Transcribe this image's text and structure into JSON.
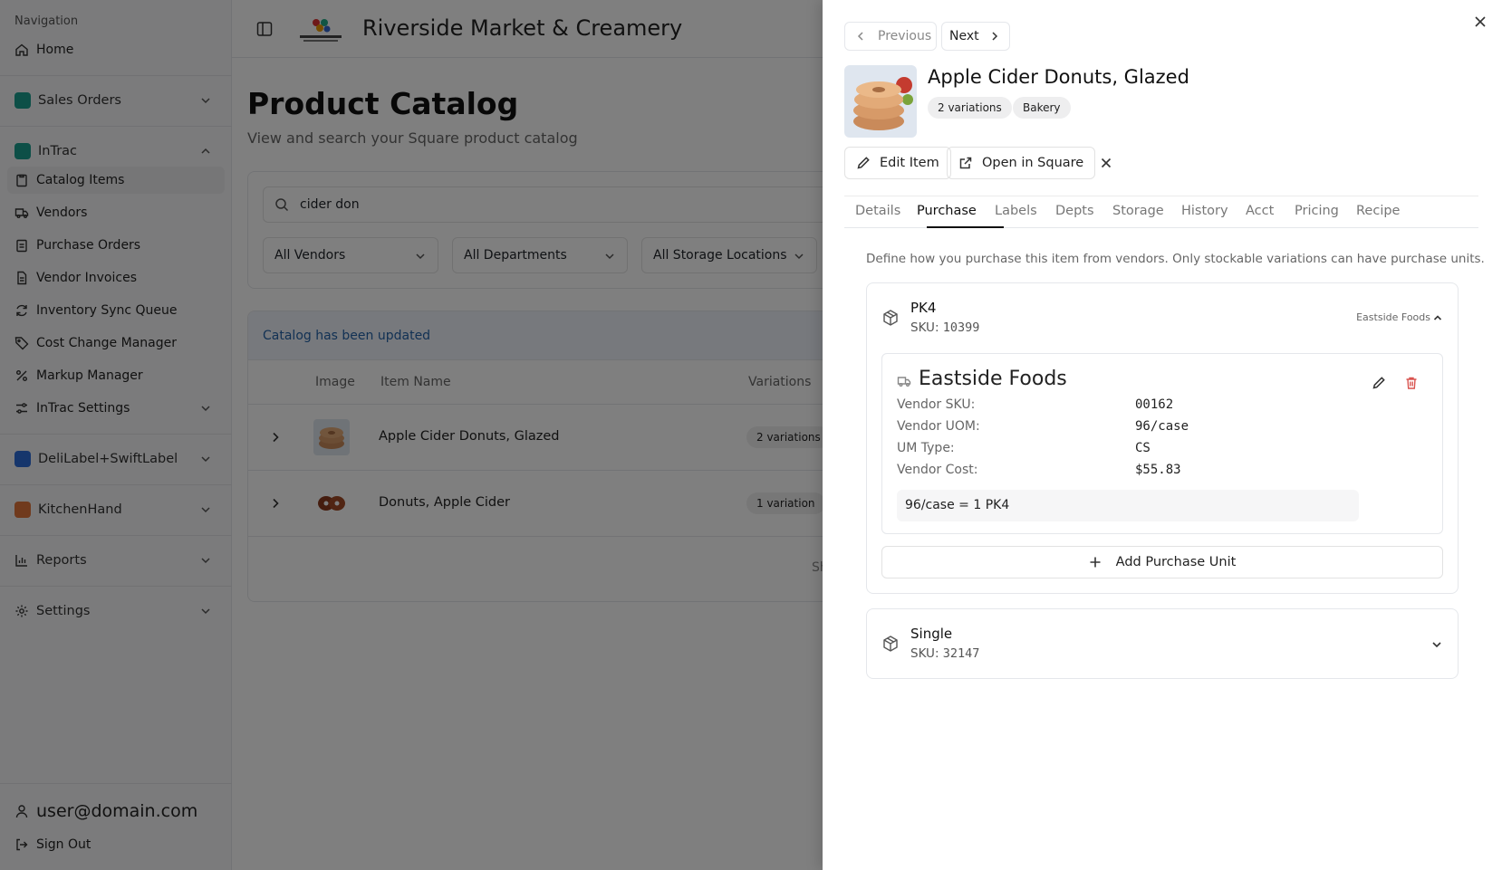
{
  "sidebar": {
    "caption": "Navigation",
    "home": "Home",
    "sales_orders": "Sales Orders",
    "intrac": "InTrac",
    "intrac_items": [
      "Catalog Items",
      "Vendors",
      "Purchase Orders",
      "Vendor Invoices",
      "Inventory Sync Queue",
      "Cost Change Manager",
      "Markup Manager",
      "InTrac Settings"
    ],
    "delilabel": "DeliLabel+SwiftLabel",
    "kitchenhand": "KitchenHand",
    "reports": "Reports",
    "settings": "Settings",
    "user_email": "user@domain.com",
    "sign_out": "Sign Out",
    "brand_colors": {
      "sales": "#1a9e8f",
      "delilabel": "#2d6cd8",
      "kitchenhand": "#e0743a"
    }
  },
  "header": {
    "store_name": "Riverside Market & Creamery"
  },
  "main": {
    "title": "Product Catalog",
    "subtitle": "View and search your Square product catalog",
    "search_value": "cider don",
    "filters": [
      "All Vendors",
      "All Departments",
      "All Storage Locations"
    ],
    "notice": "Catalog has been updated",
    "columns": [
      "Image",
      "Item Name",
      "Variations"
    ],
    "rows": [
      {
        "name": "Apple Cider Donuts, Glazed",
        "variations": "2 variations"
      },
      {
        "name": "Donuts, Apple Cider",
        "variations": "1 variation"
      }
    ],
    "pager_text": "Sh"
  },
  "drawer": {
    "prev_label": "Previous",
    "next_label": "Next",
    "item_title": "Apple Cider Donuts, Glazed",
    "pills": [
      "2 variations",
      "Bakery"
    ],
    "edit_label": "Edit Item",
    "open_square_label": "Open in Square",
    "tabs": [
      "Details",
      "Purchase",
      "Labels",
      "Depts",
      "Storage",
      "History",
      "Acct",
      "Pricing",
      "Recipe"
    ],
    "active_tab": "Purchase",
    "description": "Define how you purchase this item from vendors. Only stockable variations can have purchase units.",
    "variations": [
      {
        "name": "PK4",
        "sku_label": "SKU:",
        "sku": "10399",
        "vendor_tag": "Eastside Foods",
        "vendor": {
          "name": "Eastside Foods",
          "fields": [
            {
              "label": "Vendor SKU:",
              "value": "00162"
            },
            {
              "label": "Vendor UOM:",
              "value": "96/case"
            },
            {
              "label": "UM Type:",
              "value": "CS"
            },
            {
              "label": "Vendor Cost:",
              "value": "$55.83"
            }
          ],
          "conversion": "96/case = 1 PK4"
        },
        "add_unit_label": "Add Purchase Unit"
      },
      {
        "name": "Single",
        "sku_label": "SKU:",
        "sku": "32147"
      }
    ]
  }
}
